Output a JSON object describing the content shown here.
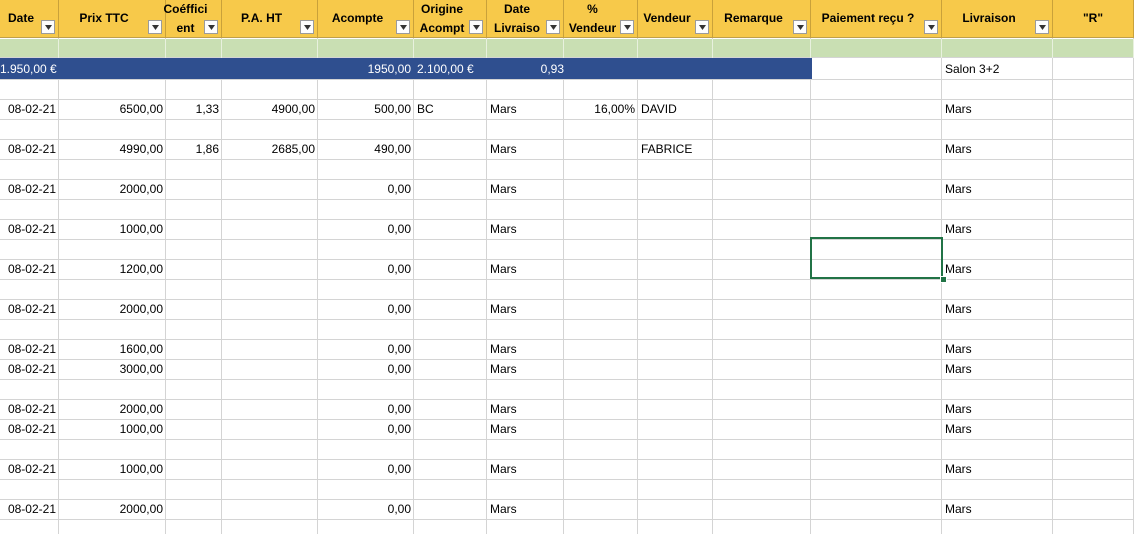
{
  "headers": [
    {
      "label": "Date"
    },
    {
      "label": "Prix TTC"
    },
    {
      "label": "Coéffici\nent"
    },
    {
      "label": "P.A. HT"
    },
    {
      "label": "Acompte"
    },
    {
      "label": "Origine\nAcompt"
    },
    {
      "label": "Date\nLivraiso"
    },
    {
      "label": "% Vendeur"
    },
    {
      "label": "Vendeur"
    },
    {
      "label": "Remarque"
    },
    {
      "label": "Paiement reçu ?"
    },
    {
      "label": "Livraison"
    },
    {
      "label": "\"R\""
    }
  ],
  "summary_row": {
    "date": "1.950,00 €",
    "acompte": "1950,00",
    "origine": "2.100,00 €",
    "date_livraison": "0,93",
    "livraison": "Salon 3+2"
  },
  "rows": [
    {
      "date": "08-02-21",
      "prix_ttc": "6500,00",
      "coefficient": "1,33",
      "pa_ht": "4900,00",
      "acompte": "500,00",
      "origine": "BC",
      "date_livraison": "Mars",
      "pct_vendeur": "16,00%",
      "vendeur": "DAVID",
      "livraison": "Mars"
    },
    {
      "date": "08-02-21",
      "prix_ttc": "4990,00",
      "coefficient": "1,86",
      "pa_ht": "2685,00",
      "acompte": "490,00",
      "origine": "",
      "date_livraison": "Mars",
      "pct_vendeur": "",
      "vendeur": "FABRICE",
      "livraison": "Mars"
    },
    {
      "date": "08-02-21",
      "prix_ttc": "2000,00",
      "coefficient": "",
      "pa_ht": "",
      "acompte": "0,00",
      "origine": "",
      "date_livraison": "Mars",
      "pct_vendeur": "",
      "vendeur": "",
      "livraison": "Mars"
    },
    {
      "date": "08-02-21",
      "prix_ttc": "1000,00",
      "coefficient": "",
      "pa_ht": "",
      "acompte": "0,00",
      "origine": "",
      "date_livraison": "Mars",
      "pct_vendeur": "",
      "vendeur": "",
      "livraison": "Mars"
    },
    {
      "date": "08-02-21",
      "prix_ttc": "1200,00",
      "coefficient": "",
      "pa_ht": "",
      "acompte": "0,00",
      "origine": "",
      "date_livraison": "Mars",
      "pct_vendeur": "",
      "vendeur": "",
      "livraison": "Mars"
    },
    {
      "date": "08-02-21",
      "prix_ttc": "2000,00",
      "coefficient": "",
      "pa_ht": "",
      "acompte": "0,00",
      "origine": "",
      "date_livraison": "Mars",
      "pct_vendeur": "",
      "vendeur": "",
      "livraison": "Mars"
    },
    {
      "date": "08-02-21",
      "prix_ttc": "1600,00",
      "coefficient": "",
      "pa_ht": "",
      "acompte": "0,00",
      "origine": "",
      "date_livraison": "Mars",
      "pct_vendeur": "",
      "vendeur": "",
      "livraison": "Mars"
    },
    {
      "date": "08-02-21",
      "prix_ttc": "3000,00",
      "coefficient": "",
      "pa_ht": "",
      "acompte": "0,00",
      "origine": "",
      "date_livraison": "Mars",
      "pct_vendeur": "",
      "vendeur": "",
      "livraison": "Mars"
    },
    {
      "date": "08-02-21",
      "prix_ttc": "2000,00",
      "coefficient": "",
      "pa_ht": "",
      "acompte": "0,00",
      "origine": "",
      "date_livraison": "Mars",
      "pct_vendeur": "",
      "vendeur": "",
      "livraison": "Mars"
    },
    {
      "date": "08-02-21",
      "prix_ttc": "1000,00",
      "coefficient": "",
      "pa_ht": "",
      "acompte": "0,00",
      "origine": "",
      "date_livraison": "Mars",
      "pct_vendeur": "",
      "vendeur": "",
      "livraison": "Mars"
    },
    {
      "date": "08-02-21",
      "prix_ttc": "1000,00",
      "coefficient": "",
      "pa_ht": "",
      "acompte": "0,00",
      "origine": "",
      "date_livraison": "Mars",
      "pct_vendeur": "",
      "vendeur": "",
      "livraison": "Mars"
    },
    {
      "date": "08-02-21",
      "prix_ttc": "2000,00",
      "coefficient": "",
      "pa_ht": "",
      "acompte": "0,00",
      "origine": "",
      "date_livraison": "Mars",
      "pct_vendeur": "",
      "vendeur": "",
      "livraison": "Mars"
    }
  ],
  "colors": {
    "header_bg": "#f7c94a",
    "band_green": "#c9dfb3",
    "band_blue": "#2f4f8f",
    "selection": "#217346",
    "gridline": "#d4d4d4"
  },
  "icons": {
    "filter": "filter-dropdown-icon"
  }
}
